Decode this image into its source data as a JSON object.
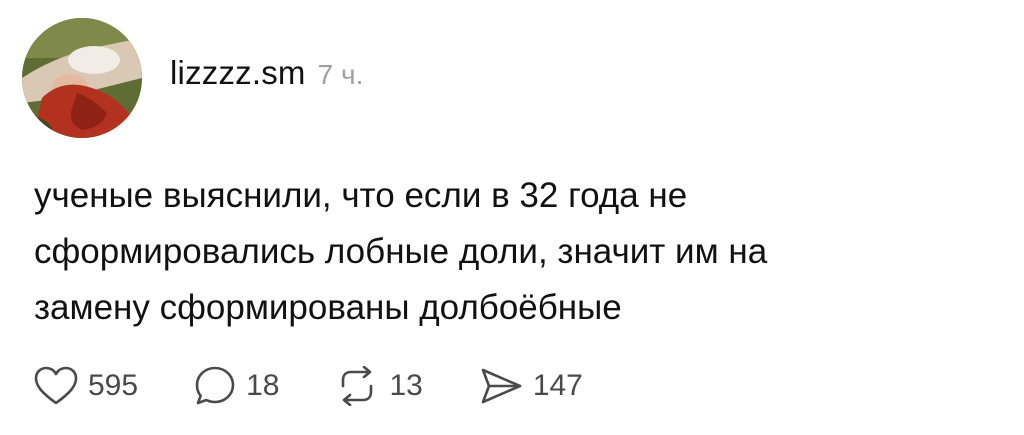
{
  "post": {
    "author": {
      "username": "lizzzz.sm",
      "avatar_icon": "avatar"
    },
    "timestamp": "7 ч.",
    "text_lines": [
      "ученые выяснили, что если в 32 года не",
      "сформировались лобные доли, значит им на",
      "замену сформированы долбоёбные"
    ],
    "actions": {
      "like": {
        "icon": "heart-icon",
        "count": "595"
      },
      "comment": {
        "icon": "comment-icon",
        "count": "18"
      },
      "repost": {
        "icon": "repost-icon",
        "count": "13"
      },
      "share": {
        "icon": "send-icon",
        "count": "147"
      }
    }
  },
  "colors": {
    "text": "#111111",
    "muted": "#a0a0a0",
    "icon": "#4a4a4a",
    "background": "#ffffff"
  }
}
